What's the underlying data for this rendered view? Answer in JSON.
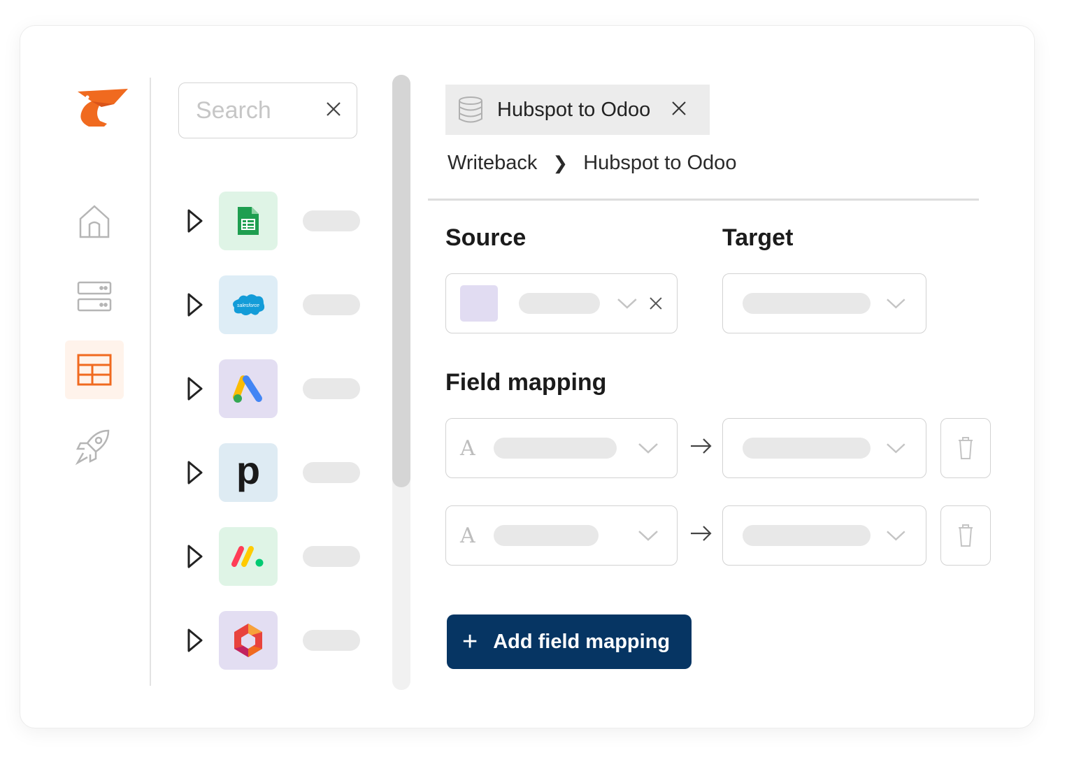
{
  "search": {
    "placeholder": "Search"
  },
  "tab": {
    "label": "Hubspot to Odoo"
  },
  "breadcrumb": {
    "items": [
      "Writeback",
      "Hubspot to Odoo"
    ],
    "separator": "❯"
  },
  "sections": {
    "source": "Source",
    "target": "Target",
    "field_mapping": "Field mapping"
  },
  "field_rows": [
    {
      "type_glyph": "A"
    },
    {
      "type_glyph": "A"
    }
  ],
  "actions": {
    "add_field_mapping": "Add field mapping",
    "add_icon": "+"
  },
  "nav": {
    "items": [
      "home-icon",
      "server-icon",
      "table-icon",
      "rocket-icon"
    ],
    "active": "table-icon"
  },
  "connectors": [
    "google-sheets-icon",
    "salesforce-icon",
    "google-ads-icon",
    "pipedrive-icon",
    "monday-icon",
    "hexagon-app-icon"
  ],
  "connector_texts": {
    "salesforce": "salesforce",
    "pipedrive": "p"
  },
  "colors": {
    "brand": "#f06a1f",
    "primary_button": "#063563",
    "active_nav_bg": "#fff3eb"
  }
}
